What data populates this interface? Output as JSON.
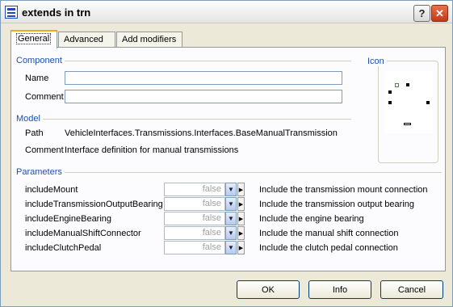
{
  "window": {
    "title": "extends in trn"
  },
  "titlebar": {
    "help_label": "?",
    "close_label": "✕"
  },
  "tabs": [
    {
      "label": "General",
      "active": true
    },
    {
      "label": "Advanced",
      "active": false
    },
    {
      "label": "Add modifiers",
      "active": false
    }
  ],
  "component": {
    "heading": "Component",
    "name_label": "Name",
    "name_value": "",
    "comment_label": "Comment",
    "comment_value": ""
  },
  "icon_section": {
    "heading": "Icon"
  },
  "model": {
    "heading": "Model",
    "path_label": "Path",
    "path_value": "VehicleInterfaces.Transmissions.Interfaces.BaseManualTransmission",
    "comment_label": "Comment",
    "comment_value": "Interface definition for manual transmissions"
  },
  "parameters": {
    "heading": "Parameters",
    "rows": [
      {
        "name": "includeMount",
        "value": "false",
        "description": "Include the transmission mount connection"
      },
      {
        "name": "includeTransmissionOutputBearing",
        "value": "false",
        "description": "Include the transmission output bearing"
      },
      {
        "name": "includeEngineBearing",
        "value": "false",
        "description": "Include the engine bearing"
      },
      {
        "name": "includeManualShiftConnector",
        "value": "false",
        "description": "Include the manual shift connection"
      },
      {
        "name": "includeClutchPedal",
        "value": "false",
        "description": "Include the clutch pedal connection"
      }
    ]
  },
  "buttons": {
    "ok": "OK",
    "info": "Info",
    "cancel": "Cancel"
  }
}
